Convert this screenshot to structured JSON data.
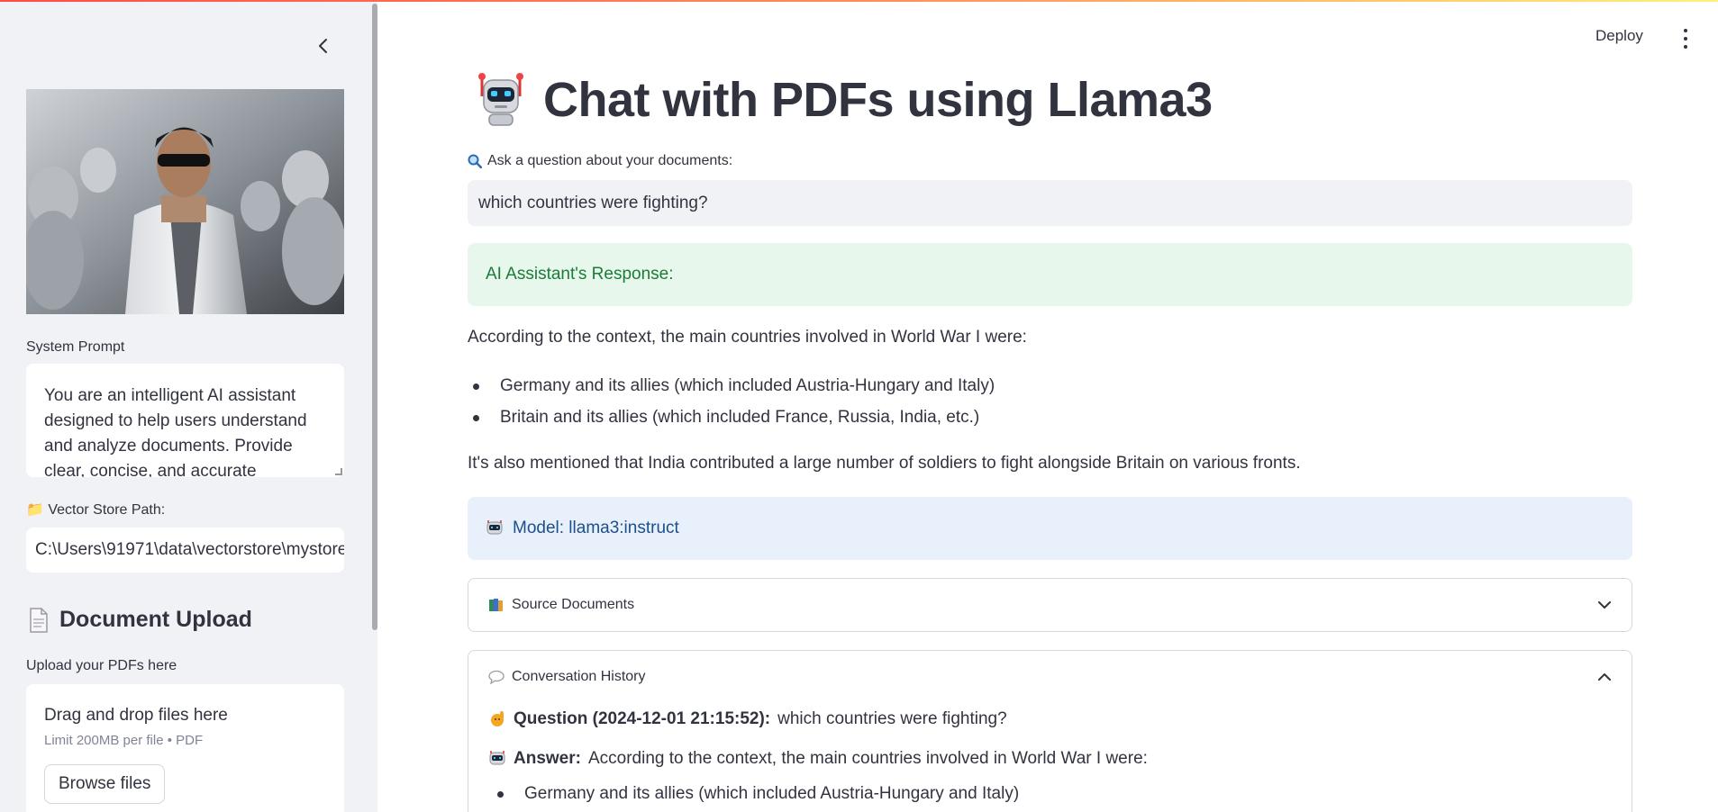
{
  "sidebar": {
    "collapse_icon": "chevron-left-icon",
    "system_prompt_label": "System Prompt",
    "system_prompt_value": "You are an intelligent AI assistant designed to help users understand and analyze documents. Provide clear, concise, and accurate",
    "vector_store_label": "📁 Vector Store Path:",
    "vector_store_value": "C:\\Users\\91971\\data\\vectorstore\\mystore",
    "upload_heading": "Document Upload",
    "upload_label": "Upload your PDFs here",
    "dropzone_title": "Drag and drop files here",
    "dropzone_limit": "Limit 200MB per file • PDF",
    "browse_button": "Browse files"
  },
  "header": {
    "deploy_label": "Deploy",
    "menu_icon": "kebab-menu-icon"
  },
  "main": {
    "title": "Chat with PDFs using Llama3",
    "question_label": "Ask a question about your documents:",
    "question_value": "which countries were fighting?",
    "response_heading": "AI Assistant's Response:",
    "response_intro": "According to the context, the main countries involved in World War I were:",
    "response_bullets": [
      "Germany and its allies (which included Austria-Hungary and Italy)",
      "Britain and its allies (which included France, Russia, India, etc.)"
    ],
    "response_outro": "It's also mentioned that India contributed a large number of soldiers to fight alongside Britain on various fronts.",
    "model_text": "Model: llama3:instruct",
    "source_docs_label": "Source Documents",
    "history_label": "Conversation History",
    "history_question_prefix": "Question (2024-12-01 21:15:52):",
    "history_question_text": "which countries were fighting?",
    "history_answer_prefix": "Answer:",
    "history_answer_text": "According to the context, the main countries involved in World War I were:",
    "history_bullet_partial": "Germany and its allies (which included Austria-Hungary and Italy)"
  },
  "colors": {
    "accent_success": "#1d7b3a",
    "accent_info": "#1d4f8a",
    "sidebar_bg": "#f0f2f6"
  }
}
